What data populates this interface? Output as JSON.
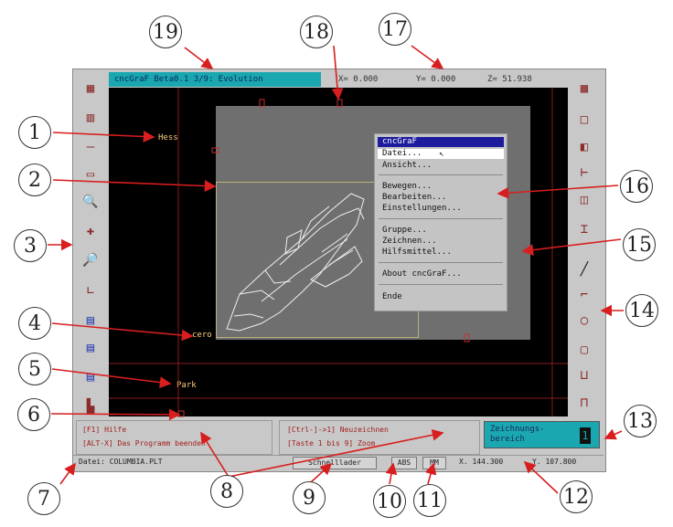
{
  "app": {
    "title": "cncGraF Beta0.1 3/9: Evolution",
    "coords": {
      "x": "X= 0.000",
      "y": "Y= 0.000",
      "z": "Z= 51.938"
    }
  },
  "canvas": {
    "labels": {
      "hess": "Hess",
      "cero": "cero",
      "park": "Park"
    }
  },
  "menu": {
    "header": "cncGraF",
    "items": [
      "Datei...",
      "Ansicht...",
      "Bewegen...",
      "Bearbeiten...",
      "Einstellungen...",
      "Gruppe...",
      "Zeichnen...",
      "Hilfsmittel...",
      "About cncGraF...",
      "Ende"
    ]
  },
  "help": {
    "line1": "[F1] Hilfe",
    "line2": "[ALT-X] Das Programm beenden"
  },
  "hints": {
    "line1": "[Ctrl-]->1] Neuzeichnen",
    "line2": "[Taste 1 bis 9] Zoom"
  },
  "zeichnungsbereich": {
    "label": "Zeichnungs- bereich",
    "value": "1"
  },
  "status": {
    "file": "Datei: COLUMBIA.PLT",
    "schnelllader": "Schnelllader",
    "abs": "ABS",
    "mm": "MM",
    "x": "X. 144.300",
    "y": "Y. 107.800"
  },
  "callouts": [
    "1",
    "2",
    "3",
    "4",
    "5",
    "6",
    "7",
    "8",
    "9",
    "10",
    "11",
    "12",
    "13",
    "14",
    "15",
    "16",
    "17",
    "18",
    "19"
  ],
  "colors": {
    "title_bg": "#1aa7b0",
    "canvas_bg": "#000000",
    "dialog_bg": "#6f6f6f",
    "menu_highlight": "#1c1c9c"
  }
}
